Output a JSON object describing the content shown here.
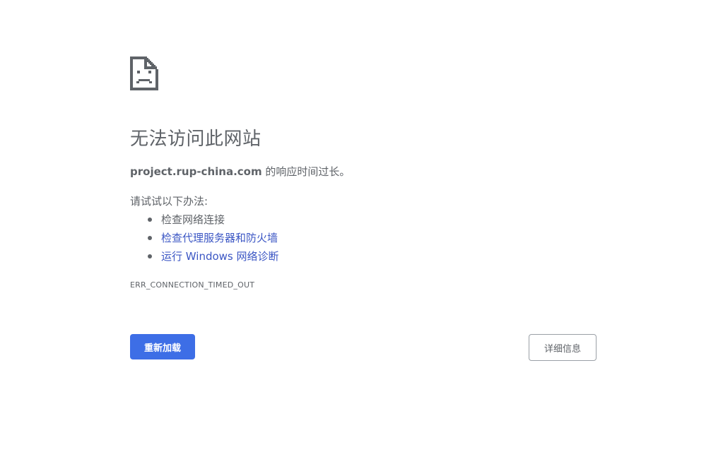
{
  "error_page": {
    "icon": "sad-page-icon",
    "title": "无法访问此网站",
    "summary": {
      "host": "project.rup-china.com",
      "message": " 的响应时间过长。"
    },
    "suggestions": {
      "heading": "请试试以下办法:",
      "items": [
        {
          "label": "检查网络连接",
          "link": false
        },
        {
          "label": "检查代理服务器和防火墙",
          "link": true
        },
        {
          "label": "运行 Windows 网络诊断",
          "link": true
        }
      ]
    },
    "error_code": "ERR_CONNECTION_TIMED_OUT",
    "reload_button": "重新加载",
    "details_button": "详细信息"
  },
  "colors": {
    "primary_button": "#3d6ee6",
    "link": "#3b56c4",
    "text": "#5f6368"
  }
}
